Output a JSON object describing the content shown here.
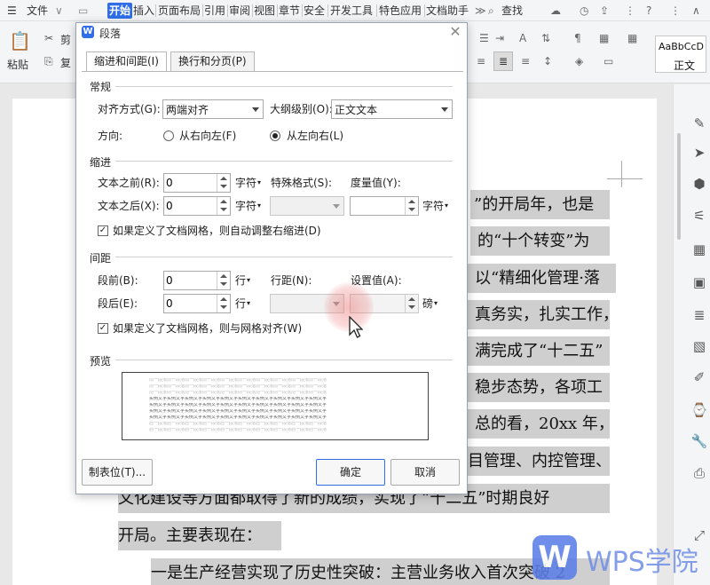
{
  "menubar": {
    "file": "文件",
    "tabs": [
      "开始",
      "插入",
      "页面布局",
      "引用",
      "审阅",
      "视图",
      "章节",
      "安全",
      "开发工具",
      "特色应用",
      "文档助手"
    ],
    "active_tab": "开始",
    "search": "查找"
  },
  "ribbon": {
    "cut": "剪",
    "paste": "粘贴",
    "copy": "复",
    "style_preview": "AaBbCcD",
    "style_name": "正文"
  },
  "dialog": {
    "title": "段落",
    "tabs": [
      "缩进和间距(I)",
      "换行和分页(P)"
    ],
    "general": {
      "section": "常规",
      "alignment_label": "对齐方式(G):",
      "alignment_value": "两端对齐",
      "outline_label": "大纲级别(O):",
      "outline_value": "正文文本",
      "direction_label": "方向:",
      "rtl_label": "从右向左(F)",
      "ltr_label": "从左向右(L)",
      "direction_selected": "从左向右(L)"
    },
    "indent": {
      "section": "缩进",
      "before_label": "文本之前(R):",
      "before_value": "0",
      "before_unit": "字符",
      "after_label": "文本之后(X):",
      "after_value": "0",
      "after_unit": "字符",
      "special_label": "特殊格式(S):",
      "special_value": "",
      "measure_label": "度量值(Y):",
      "measure_value": "",
      "measure_unit": "字符",
      "auto_adjust_label": "如果定义了文档网格，则自动调整右缩进(D)",
      "auto_adjust_checked": true
    },
    "spacing": {
      "section": "间距",
      "before_label": "段前(B):",
      "before_value": "0",
      "before_unit": "行",
      "after_label": "段后(E):",
      "after_value": "0",
      "after_unit": "行",
      "line_spacing_label": "行距(N):",
      "line_spacing_value": "",
      "set_value_label": "设置值(A):",
      "set_value": "",
      "set_value_unit": "磅",
      "snap_grid_label": "如果定义了文档网格，则与网格对齐(W)",
      "snap_grid_checked": true
    },
    "preview": {
      "section": "预览",
      "prev_text": "前一段落前一段落前一段落前一段落前一段落前一段落前一段落前一段落前一段落前一段落",
      "sample_text": "实例文字实例文字实例文字实例文字实例文字实例文字实例文字实例文字实例文字实例文字",
      "next_text": "后一段落后一段落后一段落后一段落后一段落后一段落后一段落后一段落后一段落后一段落"
    },
    "buttons": {
      "tabs": "制表位(T)...",
      "ok": "确定",
      "cancel": "取消"
    }
  },
  "document": {
    "lines": [
      "”的开局年，也是",
      "的“十个转变”为",
      "以“精细化管理·落",
      "真务实，扎实工作，",
      "满完成了“十二五”",
      "稳步态势，各项工",
      "总的看，20xx 年，",
      "目管理、内控管理、",
      "文化建设等方面都取得了新的成绩，实现了“十二五”时期良好",
      "开局。主要表现在：",
      "一是生产经营实现了历史性突破：主营业务收入首次突破 2"
    ]
  },
  "watermark": {
    "logo": "W",
    "text": "WPS学院"
  },
  "colors": {
    "accent": "#2f6ee8",
    "highlight": "#cfcfcf",
    "watermark": "#5b7fe8"
  }
}
